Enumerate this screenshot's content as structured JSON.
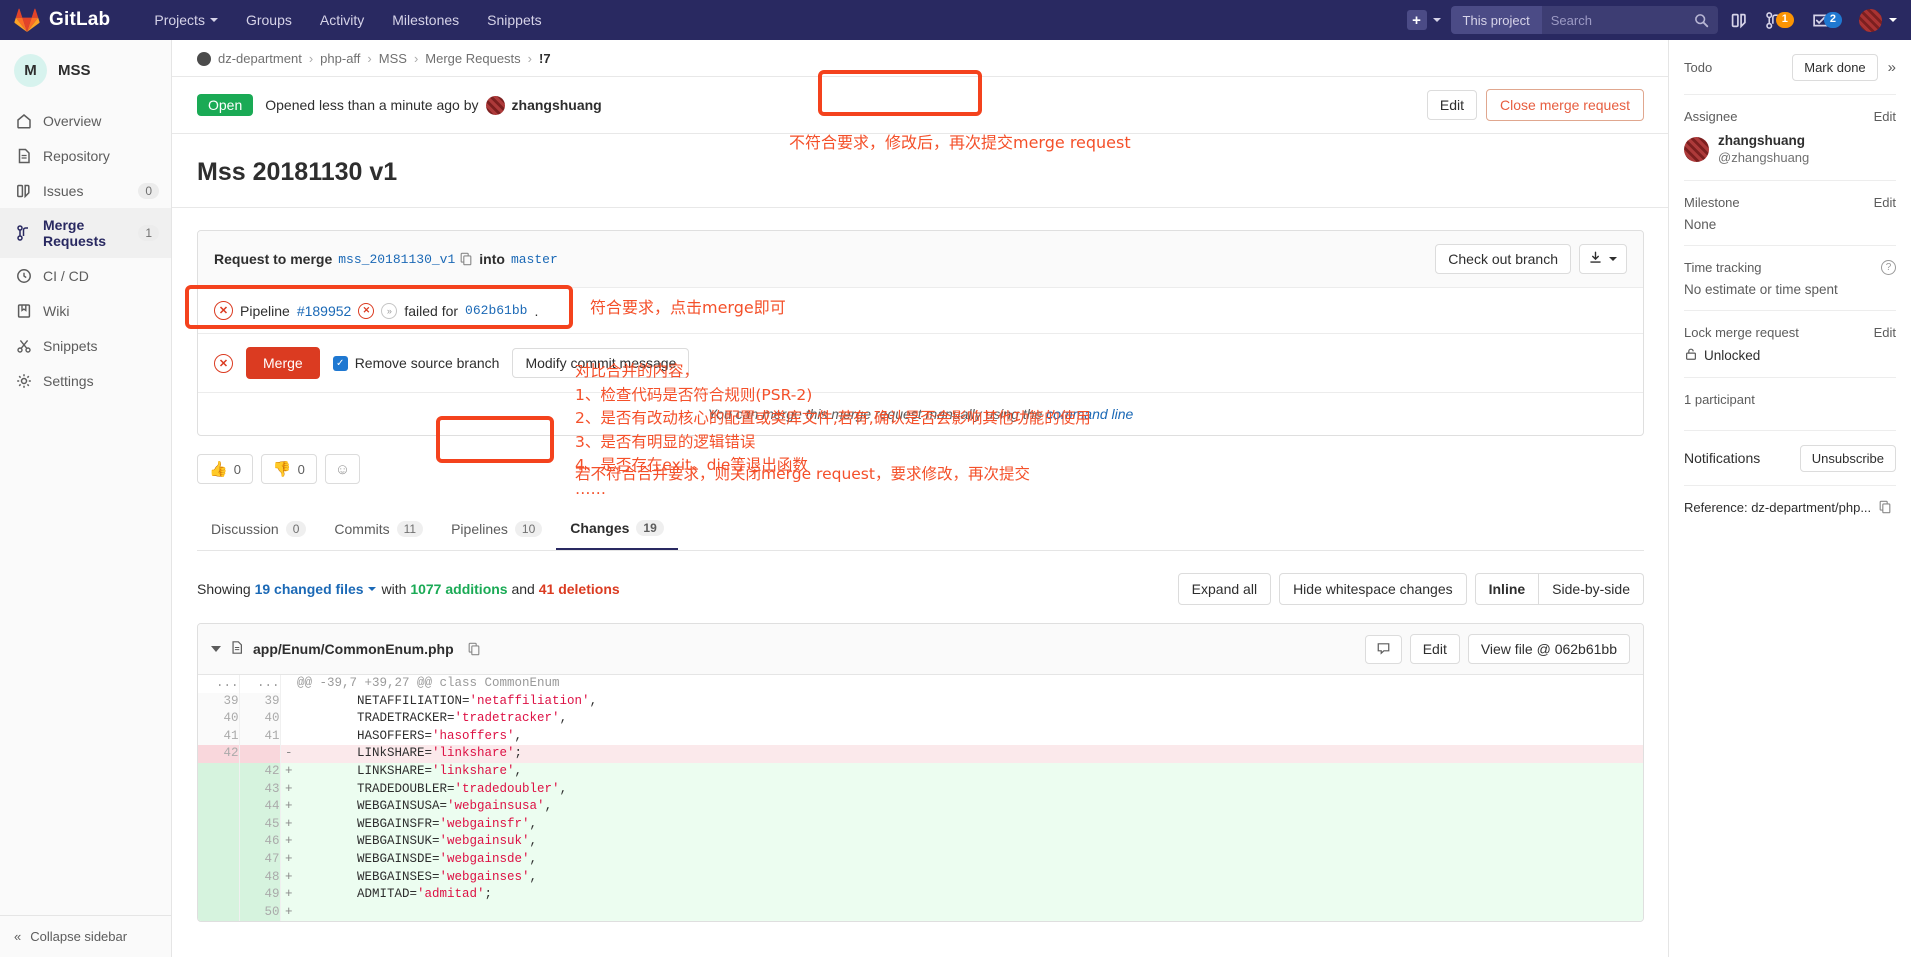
{
  "topnav": {
    "brand": "GitLab",
    "links": [
      {
        "label": "Projects",
        "caret": true
      },
      {
        "label": "Groups",
        "caret": false
      },
      {
        "label": "Activity",
        "caret": false
      },
      {
        "label": "Milestones",
        "caret": false
      },
      {
        "label": "Snippets",
        "caret": false
      }
    ],
    "plus_label": "+",
    "search_scope": "This project",
    "search_placeholder": "Search",
    "icons": {
      "issue_boards": "issue-boards-icon",
      "merge_requests": "merge-request-icon",
      "todos": "todos-icon"
    },
    "mr_badge": "1",
    "todo_badge": "2"
  },
  "sidebar": {
    "project_initial": "M",
    "project_name": "MSS",
    "items": [
      {
        "label": "Overview",
        "icon": "home-icon",
        "count": null,
        "active": false
      },
      {
        "label": "Repository",
        "icon": "document-icon",
        "count": null,
        "active": false
      },
      {
        "label": "Issues",
        "icon": "issues-icon",
        "count": "0",
        "active": false
      },
      {
        "label": "Merge Requests",
        "icon": "merge-request-icon",
        "count": "1",
        "active": true
      },
      {
        "label": "CI / CD",
        "icon": "rocket-icon",
        "count": null,
        "active": false
      },
      {
        "label": "Wiki",
        "icon": "book-icon",
        "count": null,
        "active": false
      },
      {
        "label": "Snippets",
        "icon": "scissors-icon",
        "count": null,
        "active": false
      },
      {
        "label": "Settings",
        "icon": "gear-icon",
        "count": null,
        "active": false
      }
    ],
    "collapse_label": "Collapse sidebar"
  },
  "breadcrumbs": [
    {
      "label": "dz-department"
    },
    {
      "label": "php-aff"
    },
    {
      "label": "MSS"
    },
    {
      "label": "Merge Requests"
    },
    {
      "label": "!7"
    }
  ],
  "mr": {
    "state_badge": "Open",
    "opened_text": "Opened less than a minute ago by",
    "author": "zhangshuang",
    "edit_label": "Edit",
    "close_label": "Close merge request",
    "title": "Mss 20181130 v1"
  },
  "widget": {
    "request_to_merge": "Request to merge",
    "source_branch": "mss_20181130_v1",
    "into": "into",
    "target_branch": "master",
    "checkout_label": "Check out branch",
    "download_icon": "download-icon",
    "pipeline_prefix": "Pipeline",
    "pipeline_id": "#189952",
    "pipeline_failed_text": "failed for",
    "pipeline_commit": "062b61bb",
    "pipeline_period": ".",
    "merge_label": "Merge",
    "remove_source_branch": "Remove source branch",
    "modify_commit_message": "Modify commit message",
    "manual_prefix": "You can merge this merge request manually using the",
    "manual_link": "command line"
  },
  "awards": [
    {
      "emoji": "👍",
      "count": "0",
      "name": "thumbsup-award"
    },
    {
      "emoji": "👎",
      "count": "0",
      "name": "thumbsdown-award"
    }
  ],
  "award_picker_icon": "☺",
  "tabs": [
    {
      "label": "Discussion",
      "count": "0",
      "active": false
    },
    {
      "label": "Commits",
      "count": "11",
      "active": false
    },
    {
      "label": "Pipelines",
      "count": "10",
      "active": false
    },
    {
      "label": "Changes",
      "count": "19",
      "active": true
    }
  ],
  "changes": {
    "showing": "Showing",
    "changed_files": "19 changed files",
    "with": "with",
    "additions": "1077 additions",
    "and": "and",
    "deletions": "41 deletions",
    "expand_all": "Expand all",
    "hide_whitespace": "Hide whitespace changes",
    "inline": "Inline",
    "side_by_side": "Side-by-side"
  },
  "diff_file": {
    "filename": "app/Enum/CommonEnum.php",
    "comment_icon": "comment-icon",
    "edit_label": "Edit",
    "view_file_label": "View file @ 062b61bb",
    "hunk_header": "@@ -39,7 +39,27 @@ class CommonEnum",
    "rows": [
      {
        "old": "...",
        "new": "...",
        "sign": "",
        "type": "hunk",
        "code": "@@ -39,7 +39,27 @@ class CommonEnum"
      },
      {
        "old": "39",
        "new": "39",
        "sign": "",
        "type": "ctx",
        "code": "        NETAFFILIATION='netaffiliation',"
      },
      {
        "old": "40",
        "new": "40",
        "sign": "",
        "type": "ctx",
        "code": "        TRADETRACKER='tradetracker',"
      },
      {
        "old": "41",
        "new": "41",
        "sign": "",
        "type": "ctx",
        "code": "        HASOFFERS='hasoffers',"
      },
      {
        "old": "42",
        "new": "",
        "sign": "-",
        "type": "del",
        "code": "        LINkSHARE='linkshare';"
      },
      {
        "old": "",
        "new": "42",
        "sign": "+",
        "type": "add",
        "code": "        LINKSHARE='linkshare',"
      },
      {
        "old": "",
        "new": "43",
        "sign": "+",
        "type": "add",
        "code": "        TRADEDOUBLER='tradedoubler',"
      },
      {
        "old": "",
        "new": "44",
        "sign": "+",
        "type": "add",
        "code": "        WEBGAINSUSA='webgainsusa',"
      },
      {
        "old": "",
        "new": "45",
        "sign": "+",
        "type": "add",
        "code": "        WEBGAINSFR='webgainsfr',"
      },
      {
        "old": "",
        "new": "46",
        "sign": "+",
        "type": "add",
        "code": "        WEBGAINSUK='webgainsuk',"
      },
      {
        "old": "",
        "new": "47",
        "sign": "+",
        "type": "add",
        "code": "        WEBGAINSDE='webgainsde',"
      },
      {
        "old": "",
        "new": "48",
        "sign": "+",
        "type": "add",
        "code": "        WEBGAINSES='webgainses',"
      },
      {
        "old": "",
        "new": "49",
        "sign": "+",
        "type": "add",
        "code": "        ADMITAD='admitad';"
      },
      {
        "old": "",
        "new": "50",
        "sign": "+",
        "type": "add",
        "code": ""
      }
    ]
  },
  "rightbar": {
    "todo_label": "Todo",
    "mark_done_label": "Mark done",
    "collapse_icon": "double-chevron-right-icon",
    "assignee_label": "Assignee",
    "assignee_edit": "Edit",
    "assignee_name": "zhangshuang",
    "assignee_handle": "@zhangshuang",
    "milestone_label": "Milestone",
    "milestone_edit": "Edit",
    "milestone_value": "None",
    "time_tracking_label": "Time tracking",
    "time_tracking_help": "help-icon",
    "time_tracking_value": "No estimate or time spent",
    "lock_label": "Lock merge request",
    "lock_edit": "Edit",
    "lock_value": "Unlocked",
    "participants_label": "1 participant",
    "notifications_label": "Notifications",
    "unsubscribe_label": "Unsubscribe",
    "reference_text": "Reference: dz-department/php...",
    "reference_copy_icon": "copy-icon"
  },
  "annotations": {
    "close_mr_note": "不符合要求，修改后，再次提交merge request",
    "merge_note": "符合要求，点击merge即可",
    "review_checklist": "对比合并的内容，\n1、检查代码是否符合规则(PSR-2)\n2、是否有改动核心的配置或类库文件,若有,确认是否会影响其他功能的使用\n3、是否有明显的逻辑错误\n4、是否存在exit、die等退出函数\n……",
    "close_note": "若不符合合并要求，则关闭merge request，要求修改，再次提交"
  },
  "colors": {
    "nav_bg": "#292961",
    "accent_red": "#db3b21",
    "annotation": "#f4502a",
    "open_green": "#1aaa55",
    "link_blue": "#1b69b6"
  }
}
